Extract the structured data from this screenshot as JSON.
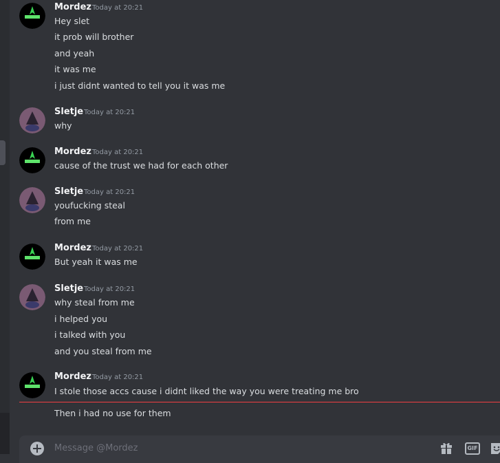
{
  "composer": {
    "placeholder": "Message @Mordez",
    "gif_label": "GIF"
  },
  "messages": [
    {
      "author": "Mordez",
      "timestamp": "Today at 20:21",
      "lines": [
        "Hey slet",
        "it prob will brother",
        "and yeah",
        "it was me",
        "i just didnt wanted to tell you it was me"
      ]
    },
    {
      "author": "Sletje",
      "timestamp": "Today at 20:21",
      "lines": [
        "why"
      ]
    },
    {
      "author": "Mordez",
      "timestamp": "Today at 20:21",
      "lines": [
        "cause of the trust we had for each other"
      ]
    },
    {
      "author": "Sletje",
      "timestamp": "Today at 20:21",
      "lines": [
        "youfucking steal",
        "from me"
      ]
    },
    {
      "author": "Mordez",
      "timestamp": "Today at 20:21",
      "lines": [
        "But yeah it was me"
      ]
    },
    {
      "author": "Sletje",
      "timestamp": "Today at 20:21",
      "lines": [
        "why steal from me",
        "i helped you",
        "i talked with you",
        "and you steal from me"
      ]
    },
    {
      "author": "Mordez",
      "timestamp": "Today at 20:21",
      "lines": [
        "I stole those accs cause i didnt liked the way you were treating me bro",
        "Then i had no use for them"
      ]
    }
  ],
  "colors": {
    "background": "#313338",
    "new_divider": "#f23f43",
    "composer": "#383a40"
  }
}
